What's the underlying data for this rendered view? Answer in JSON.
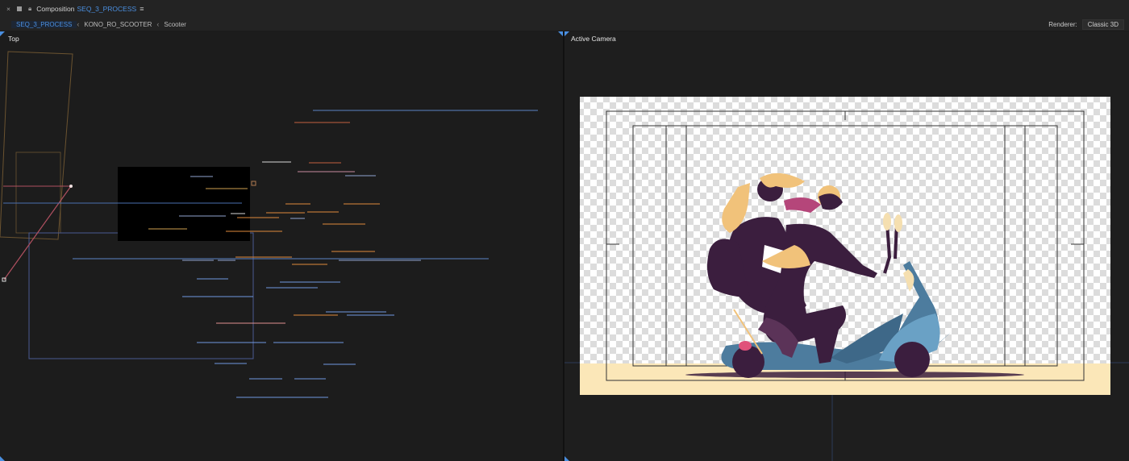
{
  "titlebar": {
    "close_glyph": "×",
    "label": "Composition",
    "composition_name": "SEQ_3_PROCESS",
    "menu_glyph": "≡"
  },
  "breadcrumbs": [
    {
      "label": "SEQ_3_PROCESS",
      "active": true
    },
    {
      "label": "KONO_RO_SCOOTER",
      "active": false
    },
    {
      "label": "Scooter",
      "active": false
    }
  ],
  "renderer": {
    "label": "Renderer:",
    "value": "Classic 3D"
  },
  "views": {
    "left_label": "Top",
    "right_label": "Active Camera"
  },
  "colors": {
    "accent": "#4a8fe0",
    "background": "#1a1a1a",
    "canvas_floor": "#fbe7b8",
    "scooter": "#4d7c9e",
    "rider_coat": "#3b1e3e",
    "hair": "#f1c27a"
  },
  "icons": [
    "close-icon",
    "color-swatch-icon",
    "lock-icon",
    "menu-icon",
    "chevron-left-icon"
  ]
}
